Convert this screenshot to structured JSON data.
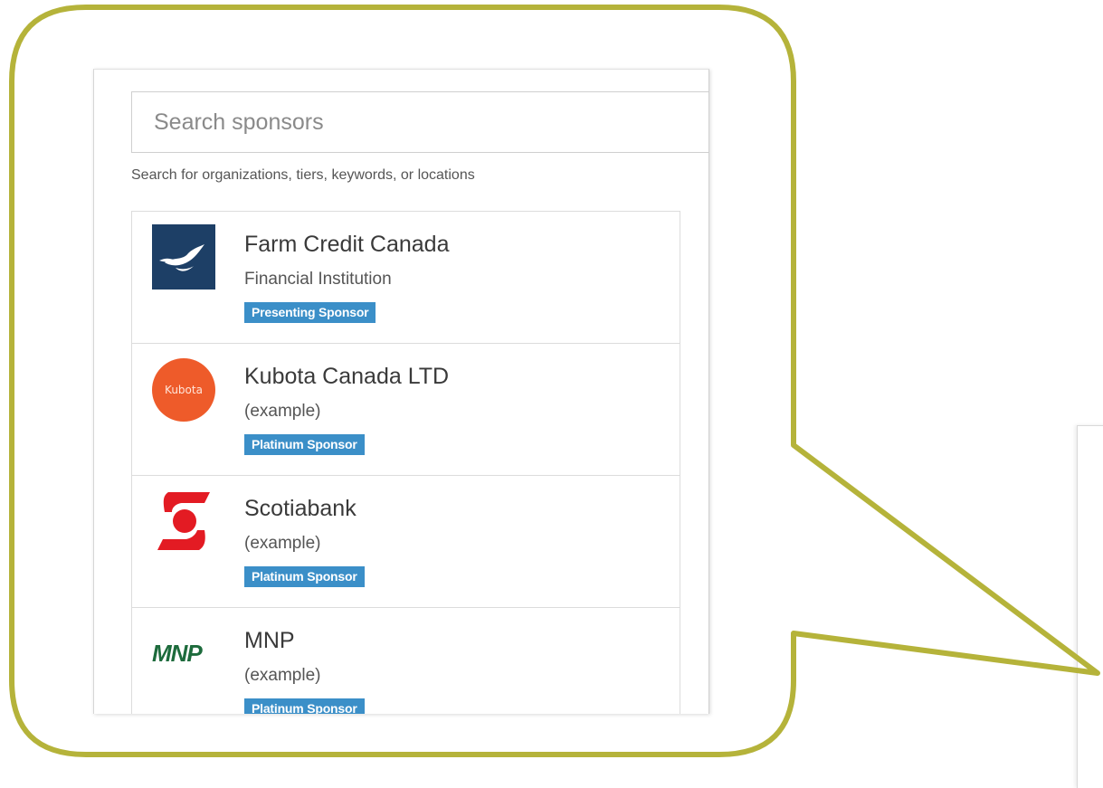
{
  "search": {
    "placeholder": "Search sponsors",
    "hint": "Search for organizations, tiers, keywords, or locations"
  },
  "sponsors": [
    {
      "name": "Farm Credit Canada",
      "subtitle": "Financial Institution",
      "tier": "Presenting Sponsor",
      "logo": "fcc-logo"
    },
    {
      "name": "Kubota Canada LTD",
      "subtitle": "(example)",
      "tier": "Platinum Sponsor",
      "logo": "kubota-logo",
      "logo_text": "Kubota"
    },
    {
      "name": "Scotiabank",
      "subtitle": "(example)",
      "tier": "Platinum Sponsor",
      "logo": "scotiabank-logo"
    },
    {
      "name": "MNP",
      "subtitle": "(example)",
      "tier": "Platinum Sponsor",
      "logo": "mnp-logo",
      "logo_text": "MNP"
    }
  ],
  "colors": {
    "callout_border": "#b5b33a",
    "badge": "#3b8fc8",
    "fcc_logo": "#1d3f66",
    "kubota_logo": "#ee5b2a",
    "scotiabank_logo": "#e31b23",
    "mnp_logo": "#1d6b3c"
  }
}
